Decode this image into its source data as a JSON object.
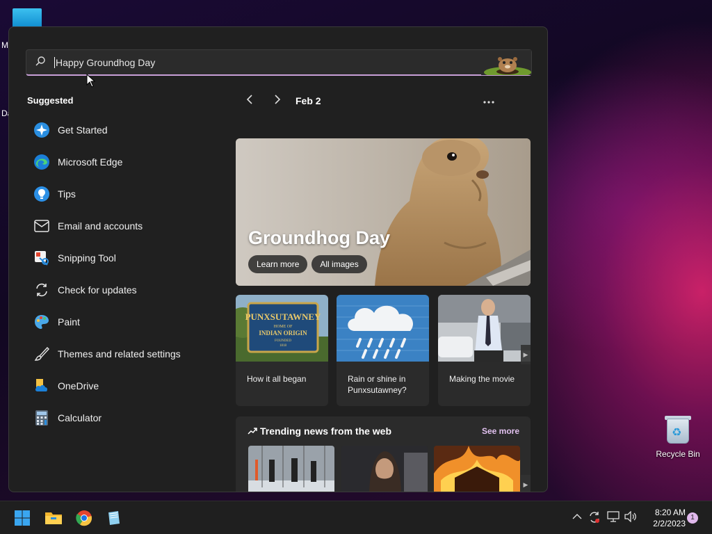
{
  "desktop": {
    "partial_labels": [
      "M",
      "Da"
    ],
    "recycle_bin_label": "Recycle Bin"
  },
  "search": {
    "value": "Happy Groundhog Day",
    "icon": "search-icon"
  },
  "suggested": {
    "title": "Suggested",
    "items": [
      {
        "label": "Get Started",
        "icon": "get-started-icon"
      },
      {
        "label": "Microsoft Edge",
        "icon": "edge-icon"
      },
      {
        "label": "Tips",
        "icon": "tips-icon"
      },
      {
        "label": "Email and accounts",
        "icon": "mail-icon"
      },
      {
        "label": "Snipping Tool",
        "icon": "snipping-tool-icon"
      },
      {
        "label": "Check for updates",
        "icon": "refresh-icon"
      },
      {
        "label": "Paint",
        "icon": "paint-icon"
      },
      {
        "label": "Themes and related settings",
        "icon": "brush-icon"
      },
      {
        "label": "OneDrive",
        "icon": "onedrive-icon"
      },
      {
        "label": "Calculator",
        "icon": "calculator-icon"
      }
    ]
  },
  "highlights": {
    "date": "Feb 2",
    "hero_title": "Groundhog Day",
    "learn_more": "Learn more",
    "all_images": "All images",
    "cards": [
      {
        "caption": "How it all began"
      },
      {
        "caption": "Rain or shine in Punxsutawney?"
      },
      {
        "caption": "Making the movie"
      }
    ],
    "sign_text": {
      "line1": "PUNXSUTAWNEY",
      "line2": "HOME OF",
      "line3": "INDIAN ORIGIN",
      "line4": "FOUNDED",
      "line5": "1818"
    }
  },
  "trending": {
    "title": "Trending news from the web",
    "see_more": "See more"
  },
  "taskbar": {
    "time": "8:20 AM",
    "date": "2/2/2023",
    "notification_count": "1"
  },
  "colors": {
    "panel": "#202020",
    "accent": "#c8a0d8"
  }
}
